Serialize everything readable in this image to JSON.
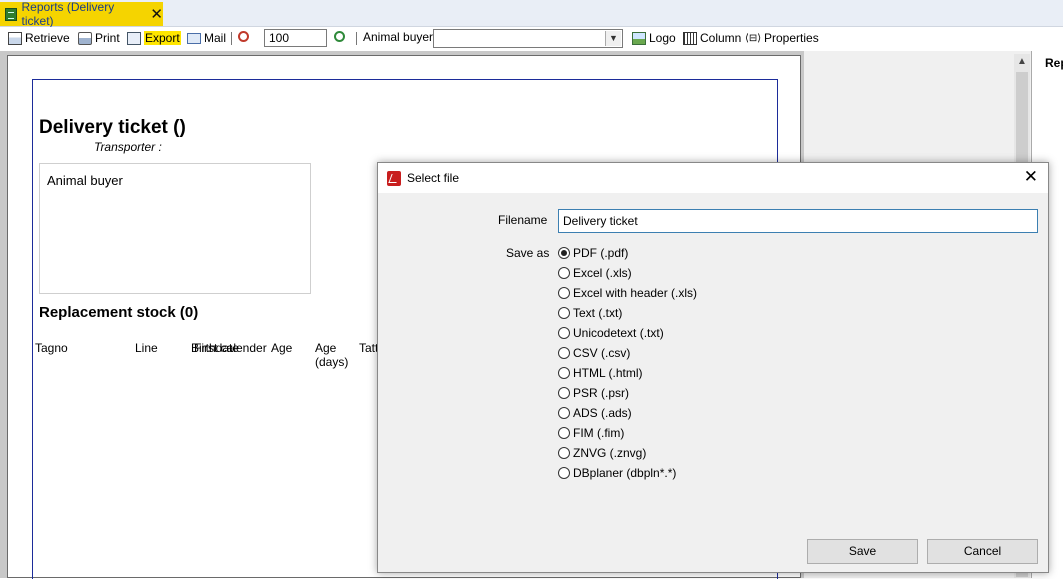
{
  "tab": {
    "label": "Reports (Delivery ticket)",
    "close": "✕"
  },
  "toolbar": {
    "retrieve": "Retrieve",
    "print": "Print",
    "export": "Export",
    "mail": "Mail",
    "zoom_value": "100",
    "buyer_label": "Animal buyer",
    "logo": "Logo",
    "column": "Column",
    "properties": "Properties"
  },
  "report": {
    "title": "Delivery ticket  ()",
    "transporter_label": "Transporter :",
    "buyer_box_label": "Animal buyer",
    "section_title": "Replacement stock  (0)",
    "columns": {
      "tagno": "Tagno",
      "line": "Line",
      "birthdate": "Birthdate",
      "first_calender": "First calender",
      "age": "Age",
      "age_days_1": "Age",
      "age_days_2": "(days)",
      "tattoo": "Tatt"
    }
  },
  "side_panel": {
    "label": "Rep"
  },
  "dialog": {
    "title": "Select file",
    "filename_label": "Filename",
    "filename_value": "Delivery ticket",
    "save_as_label": "Save as",
    "options": [
      "PDF (.pdf)",
      "Excel (.xls)",
      "Excel with header (.xls)",
      "Text (.txt)",
      "Unicodetext (.txt)",
      "CSV (.csv)",
      "HTML (.html)",
      "PSR (.psr)",
      "ADS (.ads)",
      "FIM (.fim)",
      "ZNVG (.znvg)",
      "DBplaner (dbpln*.*)"
    ],
    "selected_option": "PDF (.pdf)",
    "save_button": "Save",
    "cancel_button": "Cancel"
  },
  "colors": {
    "tab_active": "#f5d400",
    "export_highlight": "#ffe600",
    "dialog_bg": "#f0f0f0",
    "report_frame": "#1c2c9a",
    "input_focus": "#3c7fb1"
  }
}
